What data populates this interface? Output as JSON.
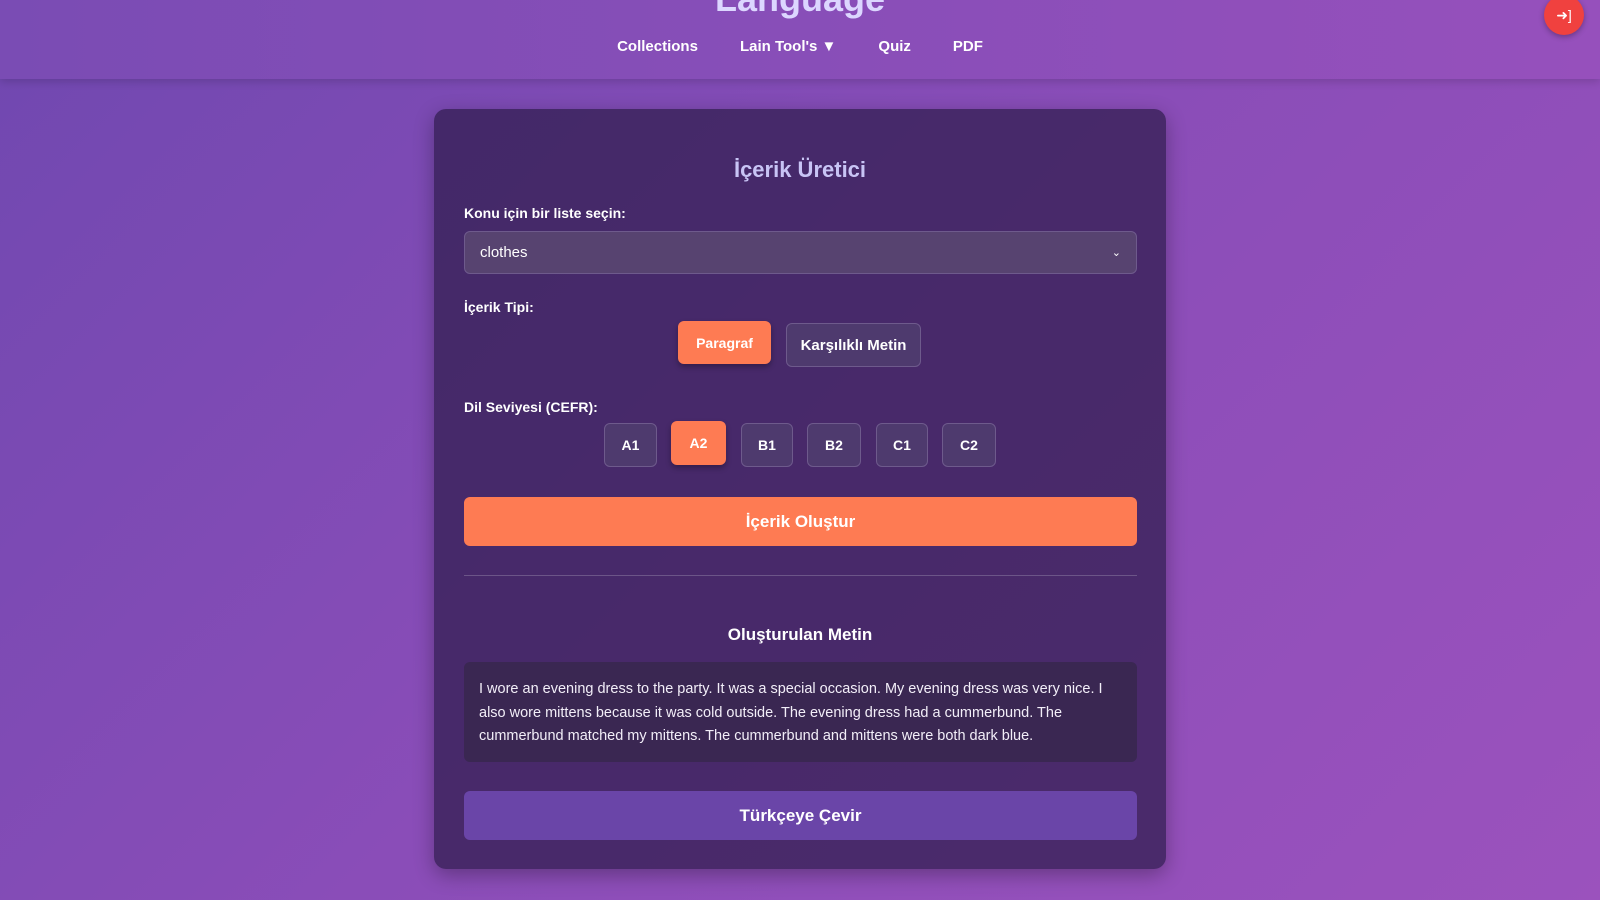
{
  "header": {
    "logo": "Language",
    "nav": [
      "Collections",
      "Lain Tool's ▼",
      "Quiz",
      "PDF"
    ],
    "logout_icon": "sign-out-icon"
  },
  "card": {
    "title": "İçerik Üretici",
    "list_label": "Konu için bir liste seçin:",
    "list_value": "clothes",
    "type_label": "İçerik Tipi:",
    "types": [
      {
        "label": "Paragraf",
        "active": true
      },
      {
        "label": "Karşılıklı Metin",
        "active": false
      }
    ],
    "level_label": "Dil Seviyesi (CEFR):",
    "levels": [
      "A1",
      "A2",
      "B1",
      "B2",
      "C1",
      "C2"
    ],
    "selected_level": "A2",
    "generate": "İçerik Oluştur",
    "output_title": "Oluşturulan Metin",
    "output_text": "I wore an evening dress to the party. It was a special occasion. My evening dress was very nice. I also wore mittens because it was cold outside. The evening dress had a cummerbund. The cummerbund matched my mittens. The cummerbund and mittens were both dark blue.",
    "translate": "Türkçeye Çevir"
  },
  "colors": {
    "accent": "#fe7b53",
    "translate": "#6a45a8",
    "logout": "#f0413f"
  }
}
